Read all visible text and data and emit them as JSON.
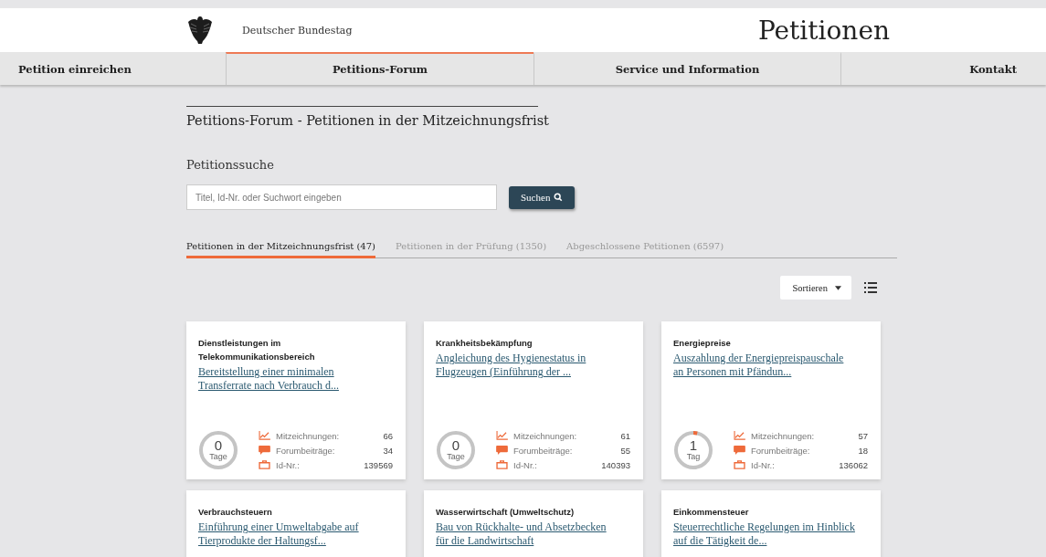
{
  "header": {
    "institution": "Deutscher Bundestag",
    "site_title": "Petitionen"
  },
  "nav": [
    {
      "label": "Petition einreichen",
      "selected": false
    },
    {
      "label": "Petitions-Forum",
      "selected": true
    },
    {
      "label": "Service und Information",
      "selected": false
    },
    {
      "label": "Kontakt",
      "selected": false
    }
  ],
  "page_title": "Petitions-Forum - Petitionen in der Mitzeichnungsfrist",
  "search": {
    "heading": "Petitionssuche",
    "placeholder": "Titel, Id-Nr. oder Suchwort eingeben",
    "button": "Suchen"
  },
  "tabs": [
    {
      "label": "Petitionen in der Mitzeichnungsfrist (47)",
      "selected": true
    },
    {
      "label": "Petitionen in der Prüfung (1350)",
      "selected": false
    },
    {
      "label": "Abgeschlossene Petitionen (6597)",
      "selected": false
    }
  ],
  "sort_button": "Sortieren",
  "petitions": [
    {
      "category": "Dienstleistungen im Telekommunikationsbereich",
      "title": "Bereitstellung einer minimalen Transferrate nach Verbrauch d...",
      "days": "0",
      "days_unit": "Tage",
      "signatures_label": "Mitzeichnungen:",
      "signatures": "66",
      "posts_label": "Forumbeiträge:",
      "posts": "34",
      "id_label": "Id-Nr.:",
      "id": "139569"
    },
    {
      "category": "Krankheitsbekämpfung",
      "title": "Angleichung des Hygienestatus in Flugzeugen (Einführung der ...",
      "days": "0",
      "days_unit": "Tage",
      "signatures_label": "Mitzeichnungen:",
      "signatures": "61",
      "posts_label": "Forumbeiträge:",
      "posts": "55",
      "id_label": "Id-Nr.:",
      "id": "140393"
    },
    {
      "category": "Energiepreise",
      "title": "Auszahlung der Energiepreispauschale an Personen mit Pfändun...",
      "days": "1",
      "days_unit": "Tag",
      "signatures_label": "Mitzeichnungen:",
      "signatures": "57",
      "posts_label": "Forumbeiträge:",
      "posts": "18",
      "id_label": "Id-Nr.:",
      "id": "136062"
    },
    {
      "category": "Verbrauchsteuern",
      "title": "Einführung einer Umweltabgabe auf Tierprodukte der Haltungsf..."
    },
    {
      "category": "Wasserwirtschaft (Umweltschutz)",
      "title": "Bau von Rückhalte- und Absetzbecken für die Landwirtschaft"
    },
    {
      "category": "Einkommensteuer",
      "title": "Steuerrechtliche Regelungen im Hinblick auf die Tätigkeit de..."
    }
  ]
}
